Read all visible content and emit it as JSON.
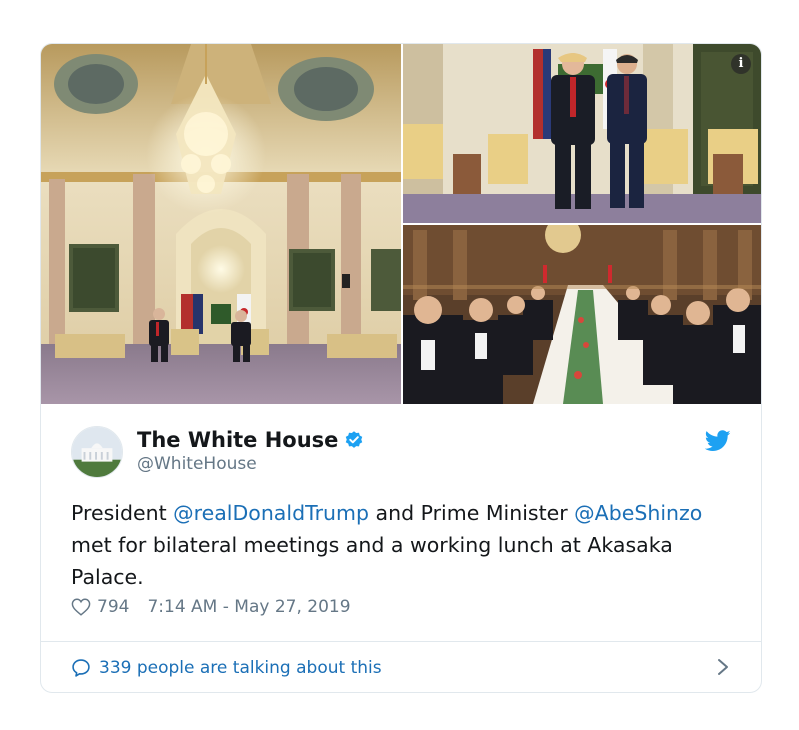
{
  "tweet": {
    "author_name": "The White House",
    "handle": "@WhiteHouse",
    "text_part1": "President ",
    "mention1": "@realDonaldTrump",
    "text_part2": " and Prime Minister ",
    "mention2": "@AbeShinzo",
    "text_part3": " met for bilateral meetings and a working lunch at Akasaka Palace.",
    "likes": "794",
    "timestamp": "7:14 AM - May 27, 2019",
    "talking": "339 people are talking about this",
    "info_badge": "i"
  },
  "colors": {
    "link": "#1b6fb6",
    "twitter_blue": "#1da1f2",
    "muted": "#657786",
    "border": "#e1e8ed"
  },
  "icons": [
    "verified-badge-icon",
    "twitter-bird-icon",
    "heart-icon",
    "speech-bubble-icon",
    "chevron-right-icon",
    "info-icon"
  ]
}
